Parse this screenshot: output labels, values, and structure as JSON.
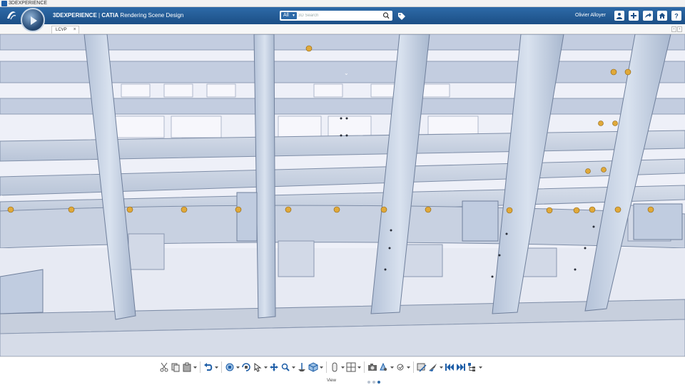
{
  "os_bar": {
    "title": "3DEXPERIENCE"
  },
  "topbar": {
    "brand": "3DEXPERIENCE",
    "separator": " | ",
    "product": "CATIA",
    "app_name": "Rendering Scene Design",
    "search_scope": "All",
    "search_placeholder": "3D Search",
    "user_name": "Olivier Alloyer",
    "accent_color": "#1c4f86"
  },
  "tabs": [
    {
      "label": "LCVP",
      "close": "×"
    }
  ],
  "panel_arrows": [
    "‹",
    "›"
  ],
  "viewport": {
    "left_expander": "›",
    "top_toggle": "⌄"
  },
  "action_bar": {
    "section_label": "View",
    "page_count": 3,
    "active_page": 3,
    "tools": [
      "cut-icon",
      "copy-icon",
      "paste-icon",
      "undo-icon",
      "fit-all-icon",
      "rotate-icon",
      "select-icon",
      "pan-icon",
      "zoom-icon",
      "normal-view-icon",
      "iso-view-icon",
      "render-style-icon",
      "multi-view-icon",
      "capture-icon",
      "visibility-icon",
      "light-icon",
      "section-icon",
      "fly-icon",
      "previous-icon",
      "next-icon",
      "tree-icon"
    ]
  }
}
